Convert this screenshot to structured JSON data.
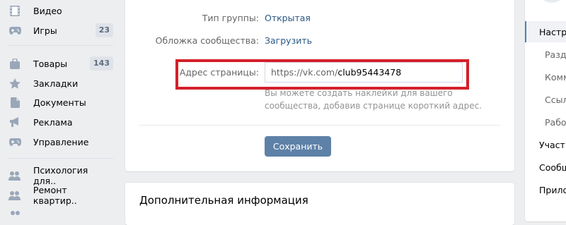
{
  "nav": {
    "items": [
      {
        "label": "Видео",
        "icon": "film-icon"
      },
      {
        "label": "Игры",
        "icon": "gamepad-icon",
        "badge": "23"
      },
      {
        "label": "Товары",
        "icon": "bag-icon",
        "badge": "143"
      },
      {
        "label": "Закладки",
        "icon": "star-icon"
      },
      {
        "label": "Документы",
        "icon": "document-icon"
      },
      {
        "label": "Реклама",
        "icon": "megaphone-icon"
      },
      {
        "label": "Управление",
        "icon": "gamepad-icon"
      },
      {
        "label": "Психология для..",
        "icon": "people-icon"
      },
      {
        "label": "Ремонт квартир..",
        "icon": "people-icon"
      }
    ]
  },
  "settings": {
    "group_type_label": "Тип группы:",
    "group_type_value": "Открытая",
    "cover_label": "Обложка сообщества:",
    "cover_value": "Загрузить",
    "address_label": "Адрес страницы:",
    "address_prefix": "https://vk.com/",
    "address_value": "club95443478",
    "hint": "Вы можете создать наклейки для вашего сообщества, добавив странице короткий адрес.",
    "save_label": "Сохранить"
  },
  "additional": {
    "title": "Дополнительная информация"
  },
  "right_menu": {
    "items": [
      {
        "label": "Настр",
        "active": true,
        "sub": false
      },
      {
        "label": "Разд",
        "active": false,
        "sub": true
      },
      {
        "label": "Комм",
        "active": false,
        "sub": true
      },
      {
        "label": "Ссыл",
        "active": false,
        "sub": true
      },
      {
        "label": "Рабо",
        "active": false,
        "sub": true
      },
      {
        "label": "Участ",
        "active": false,
        "sub": false
      },
      {
        "label": "Сообщ",
        "active": false,
        "sub": false
      },
      {
        "label": "Прило",
        "active": false,
        "sub": false
      }
    ]
  },
  "colors": {
    "accent": "#5181b8",
    "button": "#5e81a8",
    "link": "#2a5885",
    "highlight": "#d4202a"
  }
}
